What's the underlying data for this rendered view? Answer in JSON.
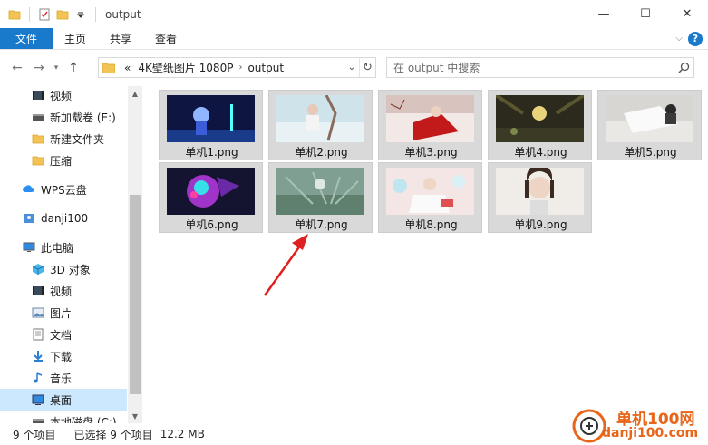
{
  "window": {
    "title": "output",
    "minimize": "—",
    "maximize": "☐",
    "close": "✕"
  },
  "ribbon": {
    "tabs": [
      "文件",
      "主页",
      "共享",
      "查看"
    ]
  },
  "address": {
    "overflow": "«",
    "crumbs": [
      "4K壁纸图片 1080P",
      "output"
    ]
  },
  "search": {
    "placeholder": "在 output 中搜索"
  },
  "sidebar": {
    "items": [
      {
        "label": "视频",
        "icon": "video-icon"
      },
      {
        "label": "新加载卷 (E:)",
        "icon": "drive-icon"
      },
      {
        "label": "新建文件夹",
        "icon": "folder-icon"
      },
      {
        "label": "压缩",
        "icon": "folder-icon"
      },
      {
        "label": "WPS云盘",
        "icon": "cloud-icon"
      },
      {
        "label": "danji100",
        "icon": "user-folder-icon"
      },
      {
        "label": "此电脑",
        "icon": "computer-icon"
      },
      {
        "label": "3D 对象",
        "icon": "3d-objects-icon"
      },
      {
        "label": "视频",
        "icon": "video-icon"
      },
      {
        "label": "图片",
        "icon": "pictures-icon"
      },
      {
        "label": "文档",
        "icon": "documents-icon"
      },
      {
        "label": "下载",
        "icon": "download-icon"
      },
      {
        "label": "音乐",
        "icon": "music-icon"
      },
      {
        "label": "桌面",
        "icon": "desktop-icon"
      },
      {
        "label": "本地磁盘 (C:)",
        "icon": "drive-icon"
      }
    ],
    "selected_index": 13
  },
  "files": [
    {
      "name": "单机1.png"
    },
    {
      "name": "单机2.png"
    },
    {
      "name": "单机3.png"
    },
    {
      "name": "单机4.png"
    },
    {
      "name": "单机5.png"
    },
    {
      "name": "单机6.png"
    },
    {
      "name": "单机7.png"
    },
    {
      "name": "单机8.png"
    },
    {
      "name": "单机9.png"
    }
  ],
  "status": {
    "count": "9 个项目",
    "selected": "已选择 9 个项目",
    "size": "12.2 MB"
  },
  "watermark": {
    "brand": "单机100网",
    "url": "danji100.com"
  },
  "colors": {
    "accent": "#1979ca",
    "selection": "#cce8ff",
    "tile_bg": "#d9d9d9",
    "annotation_arrow": "#e02020",
    "watermark": "#e8651a"
  }
}
